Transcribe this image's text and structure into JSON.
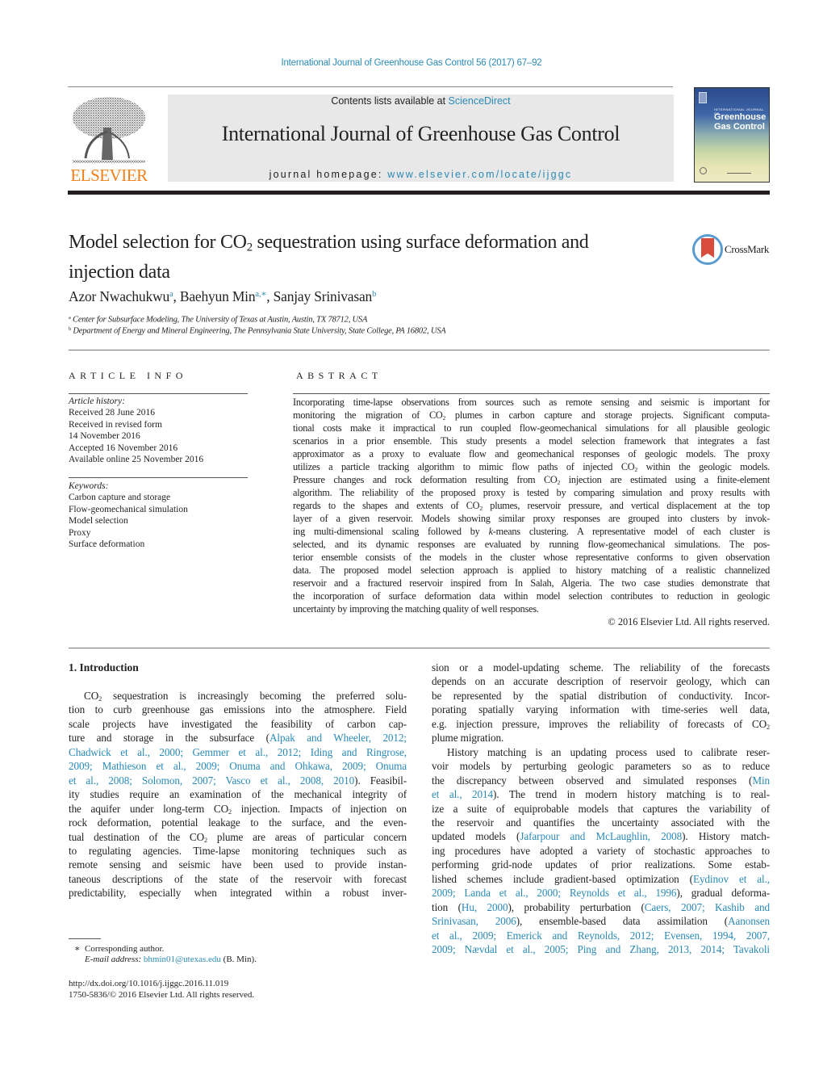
{
  "header": {
    "running_head": "International Journal of Greenhouse Gas Control 56 (2017) 67–92",
    "contents_prefix": "Contents lists available at ",
    "contents_link": "ScienceDirect",
    "journal_title": "International Journal of Greenhouse Gas Control",
    "homepage_prefix": "journal homepage: ",
    "homepage_link": "www.elsevier.com/locate/ijggc",
    "publisher_logo_text": "ELSEVIER",
    "cover": {
      "kicker": "INTERNATIONAL JOURNAL OF",
      "title_line1": "Greenhouse",
      "title_line2": "Gas Control"
    },
    "colors": {
      "link": "#2a8ab5",
      "elsevier_orange": "#f0801a",
      "band": "#e8e8e8",
      "rule": "#231f20"
    }
  },
  "article": {
    "title_part1": "Model selection for CO",
    "title_sub": "2",
    "title_part2": " sequestration using surface deformation and",
    "title_line2": "injection data",
    "crossmark_label": "CrossMark",
    "authors": [
      {
        "name": "Azor Nwachukwu",
        "marks": "a"
      },
      {
        "name": "Baehyun Min",
        "marks": "a,∗"
      },
      {
        "name": "Sanjay Srinivasan",
        "marks": "b"
      }
    ],
    "affiliations": [
      {
        "mark": "a",
        "text": "Center for Subsurface Modeling, The University of Texas at Austin, Austin, TX 78712, USA"
      },
      {
        "mark": "b",
        "text": "Department of Energy and Mineral Engineering, The Pennsylvania State University, State College, PA 16802, USA"
      }
    ]
  },
  "article_info": {
    "heading": "ARTICLE INFO",
    "history_label": "Article history:",
    "history": [
      "Received 28 June 2016",
      "Received in revised form",
      "14 November 2016",
      "Accepted 16 November 2016",
      "Available online 25 November 2016"
    ],
    "keywords_label": "Keywords:",
    "keywords": [
      "Carbon capture and storage",
      "Flow-geomechanical simulation",
      "Model selection",
      "Proxy",
      "Surface deformation"
    ]
  },
  "abstract": {
    "heading": "ABSTRACT",
    "lines": [
      "Incorporating time-lapse observations from sources such as remote sensing and seismic is important for",
      "monitoring the migration of CO₂ plumes in carbon capture and storage projects. Significant computa-",
      "tional costs make it impractical to run coupled flow-geomechanical simulations for all plausible geologic",
      "scenarios in a prior ensemble. This study presents a model selection framework that integrates a fast",
      "approximator as a proxy to evaluate flow and geomechanical responses of geologic models. The proxy",
      "utilizes a particle tracking algorithm to mimic flow paths of injected CO₂ within the geologic models.",
      "Pressure changes and rock deformation resulting from CO₂ injection are estimated using a finite-element",
      "algorithm. The reliability of the proposed proxy is tested by comparing simulation and proxy results with",
      "regards to the shapes and extents of CO₂ plumes, reservoir pressure, and vertical displacement at the top",
      "layer of a given reservoir. Models showing similar proxy responses are grouped into clusters by invok-",
      "ing multi-dimensional scaling followed by k-means clustering. A representative model of each cluster is",
      "selected, and its dynamic responses are evaluated by running flow-geomechanical simulations. The pos-",
      "terior ensemble consists of the models in the cluster whose representative conforms to given observation",
      "data. The proposed model selection approach is applied to history matching of a realistic channelized",
      "reservoir and a fractured reservoir inspired from In Salah, Algeria. The two case studies demonstrate that",
      "the incorporation of surface deformation data within model selection contributes to reduction in geologic",
      "uncertainty by improving the matching quality of well responses."
    ],
    "copyright": "© 2016 Elsevier Ltd. All rights reserved."
  },
  "body": {
    "section_heading": "1.  Introduction",
    "left_lines": [
      [
        {
          "t": "CO₂ sequestration is increasingly becoming the preferred solu-"
        }
      ],
      [
        {
          "t": "tion to curb greenhouse gas emissions into the atmosphere. Field"
        }
      ],
      [
        {
          "t": "scale projects have investigated the feasibility of carbon cap-"
        }
      ],
      [
        {
          "t": "ture and storage in the subsurface ("
        },
        {
          "t": "Alpak and Wheeler, 2012;",
          "l": 1
        }
      ],
      [
        {
          "t": "Chadwick et al., 2000; Gemmer et al., 2012; Iding and Ringrose,",
          "l": 1
        }
      ],
      [
        {
          "t": "2009; Mathieson et al., 2009; Onuma and Ohkawa, 2009; Onuma",
          "l": 1
        }
      ],
      [
        {
          "t": "et al., 2008; Solomon, 2007; Vasco et al., 2008, 2010",
          "l": 1
        },
        {
          "t": "). Feasibil-"
        }
      ],
      [
        {
          "t": "ity studies require an examination of the mechanical integrity of"
        }
      ],
      [
        {
          "t": "the aquifer under long-term CO₂ injection. Impacts of injection on"
        }
      ],
      [
        {
          "t": "rock deformation, potential leakage to the surface, and the even-"
        }
      ],
      [
        {
          "t": "tual destination of the CO₂ plume are areas of particular concern"
        }
      ],
      [
        {
          "t": "to regulating agencies. Time-lapse monitoring techniques such as"
        }
      ],
      [
        {
          "t": "remote sensing and seismic have been used to provide instan-"
        }
      ],
      [
        {
          "t": "taneous descriptions of the state of the reservoir with forecast"
        }
      ],
      [
        {
          "t": "predictability, especially when integrated within a robust inver-"
        }
      ]
    ],
    "right_lines": [
      [
        {
          "t": "sion or a model-updating scheme. The reliability of the forecasts"
        }
      ],
      [
        {
          "t": "depends on an accurate description of reservoir geology, which can"
        }
      ],
      [
        {
          "t": "be represented by the spatial distribution of conductivity. Incor-"
        }
      ],
      [
        {
          "t": "porating spatially varying information with time-series well data,"
        }
      ],
      [
        {
          "t": "e.g. injection pressure, improves the reliability of forecasts of CO₂"
        }
      ],
      [
        {
          "t": "plume migration."
        }
      ],
      [
        {
          "t": "History matching is an updating process used to calibrate reser-"
        }
      ],
      [
        {
          "t": "voir models by perturbing geologic parameters so as to reduce"
        }
      ],
      [
        {
          "t": "the discrepancy between observed and simulated responses ("
        },
        {
          "t": "Min",
          "l": 1
        }
      ],
      [
        {
          "t": "et al., 2014",
          "l": 1
        },
        {
          "t": "). The trend in modern history matching is to real-"
        }
      ],
      [
        {
          "t": "ize a suite of equiprobable models that captures the variability of"
        }
      ],
      [
        {
          "t": "the reservoir and quantifies the uncertainty associated with the"
        }
      ],
      [
        {
          "t": "updated models ("
        },
        {
          "t": "Jafarpour and McLaughlin, 2008",
          "l": 1
        },
        {
          "t": "). History match-"
        }
      ],
      [
        {
          "t": "ing procedures have adopted a variety of stochastic approaches to"
        }
      ],
      [
        {
          "t": "performing grid-node updates of prior realizations. Some estab-"
        }
      ],
      [
        {
          "t": "lished schemes include gradient-based optimization ("
        },
        {
          "t": "Eydinov et al.,",
          "l": 1
        }
      ],
      [
        {
          "t": "2009; Landa et al., 2000; Reynolds et al., 1996",
          "l": 1
        },
        {
          "t": "), gradual deforma-"
        }
      ],
      [
        {
          "t": "tion ("
        },
        {
          "t": "Hu, 2000",
          "l": 1
        },
        {
          "t": "), probability perturbation ("
        },
        {
          "t": "Caers, 2007; Kashib and",
          "l": 1
        }
      ],
      [
        {
          "t": "Srinivasan, 2006",
          "l": 1
        },
        {
          "t": "), ensemble-based data assimilation ("
        },
        {
          "t": "Aanonsen",
          "l": 1
        }
      ],
      [
        {
          "t": "et al., 2009; Emerick and Reynolds, 2012; Evensen, 1994, 2007,",
          "l": 1
        }
      ],
      [
        {
          "t": "2009; Nævdal et al., 2005; Ping and Zhang, 2013, 2014; Tavakoli",
          "l": 1
        }
      ]
    ]
  },
  "footnotes": {
    "corresponding_mark": "∗",
    "corresponding_text": "Corresponding author.",
    "email_label": "E-mail address: ",
    "email": "bhmin01@utexas.edu",
    "email_suffix": " (B. Min).",
    "doi": "http://dx.doi.org/10.1016/j.ijggc.2016.11.019",
    "issn_copyright": "1750-5836/© 2016 Elsevier Ltd. All rights reserved."
  }
}
